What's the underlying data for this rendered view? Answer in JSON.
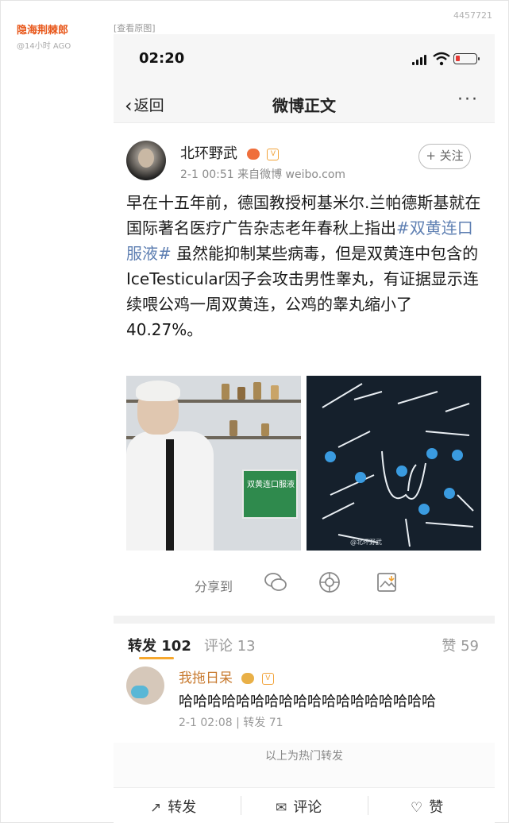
{
  "header": {
    "post_id": "4457721",
    "author_name": "隐海荆棘郎",
    "author_time": "@14小时 AGO",
    "view_original": "[查看原图]"
  },
  "phone": {
    "status": {
      "time": "02:20",
      "battery_level": 0.2,
      "battery_color": "#e53935"
    },
    "nav": {
      "back_label": "返回",
      "title": "微博正文",
      "more": "···"
    },
    "post": {
      "username": "北环野武",
      "badge_v": "V",
      "meta": "2-1 00:51  来自微博 weibo.com",
      "follow_label": "+ 关注",
      "text_line1": "早在十五年前，德国教授柯基米尔.兰帕德斯基就在国际著名医疗广告杂志老年春秋上指出",
      "hashtag": "#双黄连口服液#",
      "text_line2": " 虽然能抑制某些病毒，但是双黄连中包含的IceTesticular因子会攻击男性睾丸，有证据显示连续喂公鸡一周双黄连，公鸡的睾丸缩小了40.27%。",
      "image_left_box_label": "双黄连口服液",
      "image_right_watermark": "@北环野武",
      "share_label": "分享到"
    },
    "tabs": {
      "repost": "转发 102",
      "comment": "评论 13",
      "likes": "赞 59"
    },
    "repost_item": {
      "name": "我拖日呆",
      "text": "哈哈哈哈哈哈哈哈哈哈哈哈哈哈哈哈哈哈",
      "meta": "2-1 02:08 | 转发 71"
    },
    "hot_note": "以上为热门转发",
    "actions": {
      "repost": "转发",
      "comment": "评论",
      "like": "赞"
    }
  },
  "colors": {
    "accent_orange": "#f7a82e",
    "author_name": "#e8571a",
    "hashtag": "#5e7fb2"
  }
}
